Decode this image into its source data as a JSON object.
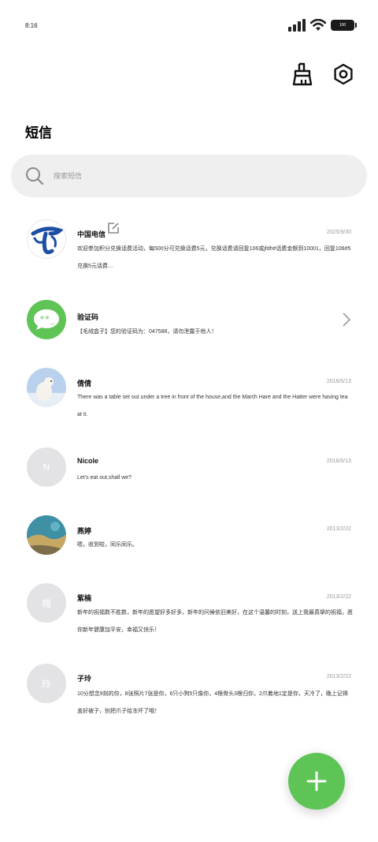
{
  "status_bar": {
    "time": "8:16",
    "battery": "100"
  },
  "header": {
    "title": "短信"
  },
  "search": {
    "placeholder": "搜索短信"
  },
  "conversations": [
    {
      "name": "中国电信",
      "date": "2025/9/30",
      "preview": "欢迎参加积分兑换话费活动，每500分可兑换话费5元，兑换话费请回复106或jfdh#话费金额到10001，回复106#5兑换5元话费…",
      "avatar_icon": "china-telecom-logo",
      "has_edit_badge": true
    },
    {
      "name": "验证码",
      "date": "",
      "preview": "【毛绒盒子】您的验证码为：047588，请勿泄露于他人！",
      "avatar_icon": "message-code-icon",
      "has_chevron": true
    },
    {
      "name": "倩倩",
      "date": "2016/6/13",
      "preview": "There was a table set out under a tree in front of the house,and the March Hare and the Hatter were having tea at it.",
      "avatar_icon": "polar-bear-photo"
    },
    {
      "name": "Nicole",
      "date": "2016/6/13",
      "preview": "Let's eat out,shall we?",
      "avatar_letter": "N"
    },
    {
      "name": "燕婷",
      "date": "2013/2/22",
      "preview": "嗯，收到啦，同乐同乐。",
      "avatar_icon": "landscape-photo"
    },
    {
      "name": "紫楠",
      "date": "2013/2/22",
      "preview": "新年的祝福数不胜数，新年的愿望好多好多，新年的问候依旧美好，在这个温馨的时刻，送上我最真挚的祝福，愿你新年健康加平安，幸福又快乐！",
      "avatar_letter": "楠"
    },
    {
      "name": "子玲",
      "date": "2013/2/22",
      "preview": "10分想念9刻的你，8张照片7张是你，6只小狗5只像你，4根骨头3根归你，2爪着地1定是你，天冷了，晚上记得盖好被子，别把爪子给冻坏了哦！",
      "avatar_letter": "玲"
    }
  ],
  "colors": {
    "accent": "#5ec455",
    "telecom_blue": "#1c4fa3",
    "search_bg": "#efefef"
  }
}
